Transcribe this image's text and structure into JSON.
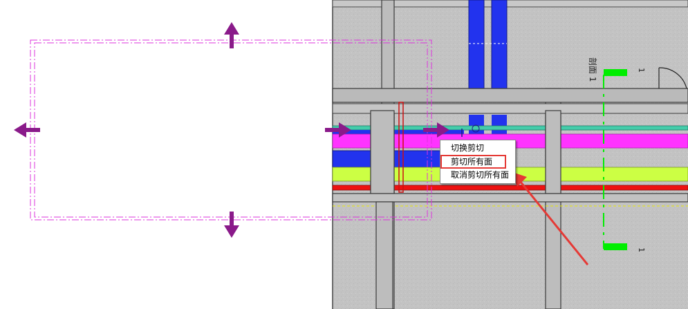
{
  "colors": {
    "floor": "#c3c3c3",
    "wall": "#b9b9b9",
    "wall_edge": "#4a4a4a",
    "duct_blue": "#2233ee",
    "duct_magenta": "#ff33ff",
    "duct_yellow_green": "#ccff44",
    "pipe_red": "#ee1111",
    "pipe_teal": "#44ccaa",
    "section_marker": "#00ee00",
    "crop_region": "#dd33dd",
    "grip_arrow": "#8a1a8a",
    "annotation_highlight": "#e53935"
  },
  "drawing": {
    "section_label": "剖面 1",
    "section_end_tag_top": "1",
    "section_end_tag_bottom": "1"
  },
  "context_menu": {
    "items": [
      {
        "label": "切换剪切",
        "highlighted": false
      },
      {
        "label": "剪切所有面",
        "highlighted": true
      },
      {
        "label": "取消剪切所有面",
        "highlighted": false
      }
    ]
  }
}
